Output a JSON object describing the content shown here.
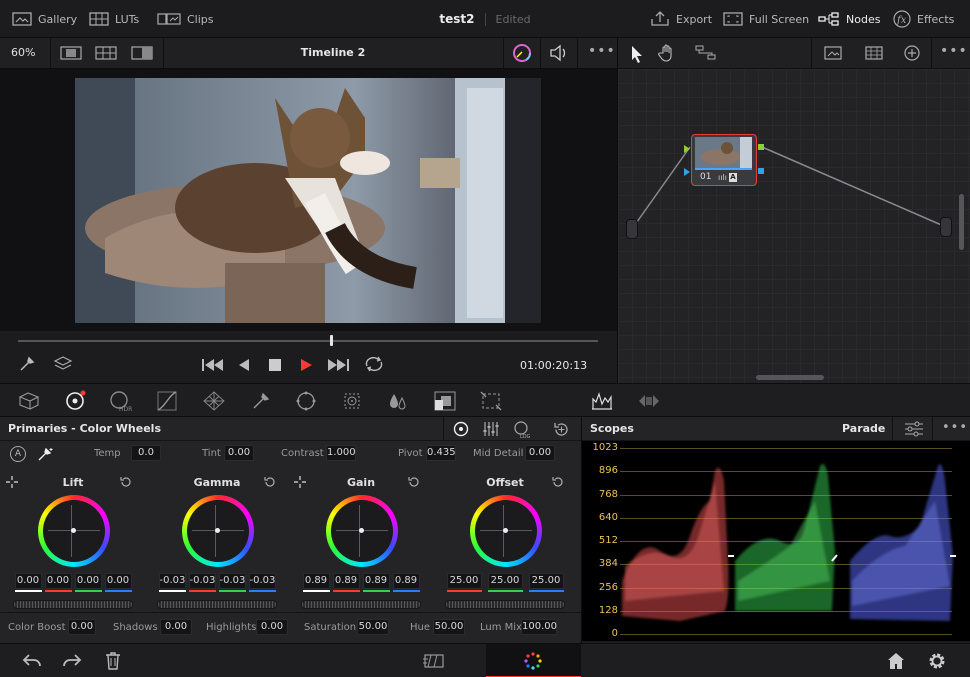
{
  "topbar": {
    "gallery": "Gallery",
    "luts": "LUTs",
    "clips": "Clips",
    "project_name": "test2",
    "project_status": "Edited",
    "export": "Export",
    "fullscreen": "Full Screen",
    "nodes": "Nodes",
    "effects": "Effects"
  },
  "viewer": {
    "zoom": "60%",
    "timeline_name": "Timeline 2",
    "timecode": "01:00:20:13",
    "playhead_fraction": 0.54
  },
  "nodes": {
    "node_label": "01"
  },
  "primaries": {
    "title": "Primaries - Color Wheels",
    "top_params": [
      {
        "label": "Temp",
        "value": "0.0"
      },
      {
        "label": "Tint",
        "value": "0.00"
      },
      {
        "label": "Contrast",
        "value": "1.000"
      },
      {
        "label": "Pivot",
        "value": "0.435"
      },
      {
        "label": "Mid Detail",
        "value": "0.00"
      }
    ],
    "wheels": [
      {
        "name": "Lift",
        "values": [
          "0.00",
          "0.00",
          "0.00",
          "0.00"
        ]
      },
      {
        "name": "Gamma",
        "values": [
          "-0.03",
          "-0.03",
          "-0.03",
          "-0.03"
        ]
      },
      {
        "name": "Gain",
        "values": [
          "0.89",
          "0.89",
          "0.89",
          "0.89"
        ]
      },
      {
        "name": "Offset",
        "values": [
          "25.00",
          "25.00",
          "25.00"
        ]
      }
    ],
    "bottom_params": [
      {
        "label": "Color Boost",
        "value": "0.00"
      },
      {
        "label": "Shadows",
        "value": "0.00"
      },
      {
        "label": "Highlights",
        "value": "0.00"
      },
      {
        "label": "Saturation",
        "value": "50.00"
      },
      {
        "label": "Hue",
        "value": "50.00"
      },
      {
        "label": "Lum Mix",
        "value": "100.00"
      }
    ]
  },
  "scopes": {
    "title": "Scopes",
    "mode": "Parade",
    "ticks": [
      "1023",
      "896",
      "768",
      "640",
      "512",
      "384",
      "256",
      "128",
      "0"
    ]
  },
  "colors": {
    "accent_red": "#ff3b30",
    "node_border": "#e0403a",
    "scope_grid": "#e8c35b",
    "red_channel": "#ff5a5a",
    "green_channel": "#3ddc5a",
    "blue_channel": "#5a6bff"
  }
}
